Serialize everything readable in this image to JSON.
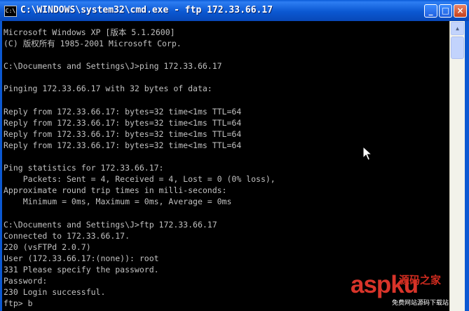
{
  "window": {
    "title": "C:\\WINDOWS\\system32\\cmd.exe - ftp 172.33.66.17",
    "icon": "cmd-icon",
    "controls": {
      "minimize": "_",
      "maximize": "□",
      "close": "×"
    }
  },
  "console": {
    "lines": [
      "Microsoft Windows XP [版本 5.1.2600]",
      "(C) 版权所有 1985-2001 Microsoft Corp.",
      "",
      "C:\\Documents and Settings\\J>ping 172.33.66.17",
      "",
      "Pinging 172.33.66.17 with 32 bytes of data:",
      "",
      "Reply from 172.33.66.17: bytes=32 time<1ms TTL=64",
      "Reply from 172.33.66.17: bytes=32 time<1ms TTL=64",
      "Reply from 172.33.66.17: bytes=32 time<1ms TTL=64",
      "Reply from 172.33.66.17: bytes=32 time<1ms TTL=64",
      "",
      "Ping statistics for 172.33.66.17:",
      "    Packets: Sent = 4, Received = 4, Lost = 0 (0% loss),",
      "Approximate round trip times in milli-seconds:",
      "    Minimum = 0ms, Maximum = 0ms, Average = 0ms",
      "",
      "C:\\Documents and Settings\\J>ftp 172.33.66.17",
      "Connected to 172.33.66.17.",
      "220 (vsFTPd 2.0.7)",
      "User (172.33.66.17:(none)): root",
      "331 Please specify the password.",
      "Password:",
      "230 Login successful.",
      "ftp> b"
    ]
  },
  "watermark": {
    "brand": "aspku",
    "tagline": "源码之家",
    "subtitle": "免费网站源码下载站"
  },
  "colors": {
    "titlebar": "#0b58d2",
    "console_bg": "#000000",
    "console_text": "#c0c0c0",
    "watermark_red": "#d8342a"
  }
}
